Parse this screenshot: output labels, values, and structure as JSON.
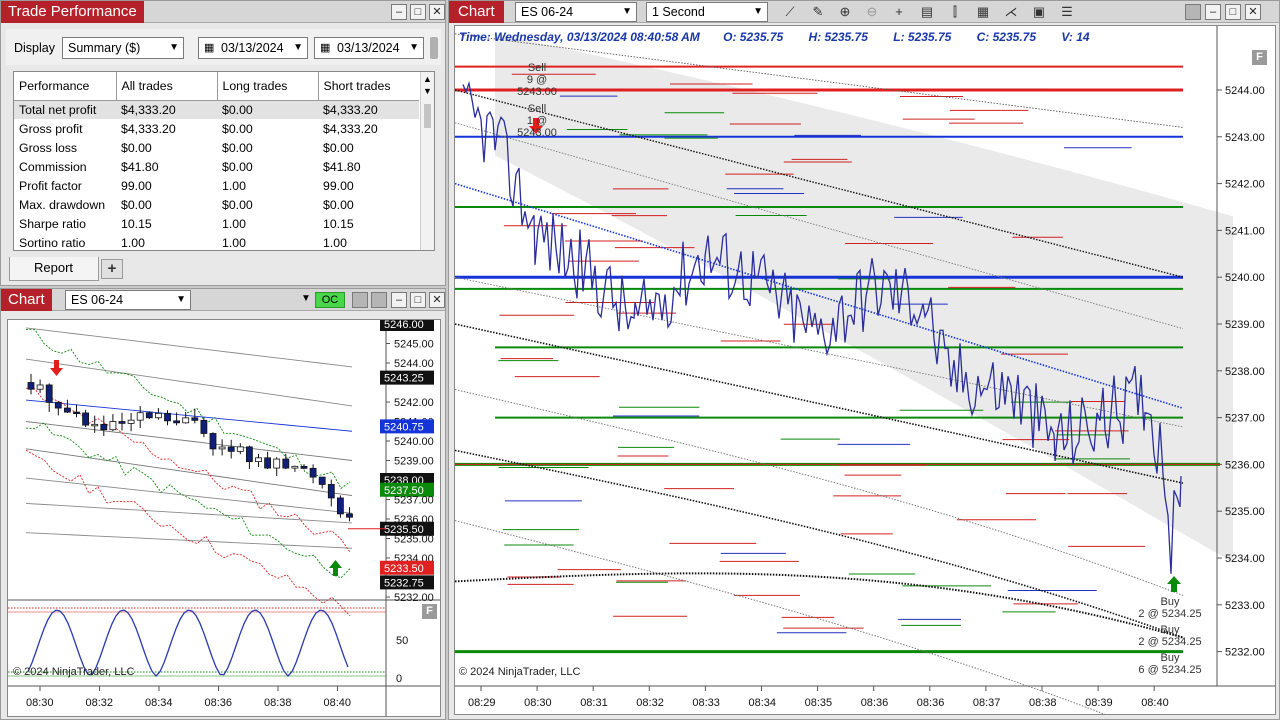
{
  "trade_performance": {
    "title": "Trade Performance",
    "display_label": "Display",
    "display_value": "Summary ($)",
    "date_from": "03/13/2024",
    "date_to": "03/13/2024",
    "tab_label": "Report",
    "columns": [
      "Performance",
      "All trades",
      "Long trades",
      "Short trades"
    ],
    "rows": [
      [
        "Total net profit",
        "$4,333.20",
        "$0.00",
        "$4,333.20"
      ],
      [
        "Gross profit",
        "$4,333.20",
        "$0.00",
        "$4,333.20"
      ],
      [
        "Gross loss",
        "$0.00",
        "$0.00",
        "$0.00"
      ],
      [
        "Commission",
        "$41.80",
        "$0.00",
        "$41.80"
      ],
      [
        "Profit factor",
        "99.00",
        "1.00",
        "99.00"
      ],
      [
        "Max. drawdown",
        "$0.00",
        "$0.00",
        "$0.00"
      ],
      [
        "Sharpe ratio",
        "10.15",
        "1.00",
        "10.15"
      ],
      [
        "Sortino ratio",
        "1.00",
        "1.00",
        "1.00"
      ]
    ]
  },
  "small_chart": {
    "title": "Chart",
    "instrument": "ES 06-24",
    "oc_label": "OC",
    "copyright": "© 2024 NinjaTrader, LLC",
    "price_axis": [
      "5246.00",
      "5245.00",
      "5244.00",
      "5243.25",
      "5242.00",
      "5241.00",
      "5240.75",
      "5240.00",
      "5239.00",
      "5238.00",
      "5237.50",
      "5237.00",
      "5236.00",
      "5235.50",
      "5235.00",
      "5234.00",
      "5233.50",
      "5232.75",
      "5232.00"
    ],
    "osc_axis": [
      "50",
      "0"
    ],
    "time_axis": [
      "08:30",
      "08:32",
      "08:34",
      "08:36",
      "08:38",
      "08:40"
    ]
  },
  "main_chart": {
    "title": "Chart",
    "instrument": "ES 06-24",
    "interval": "1 Second",
    "info_time": "Time: Wednesday, 03/13/2024 08:40:58 AM",
    "info_open": "O: 5235.75",
    "info_high": "H: 5235.75",
    "info_low": "L: 5235.75",
    "info_close": "C: 5235.75",
    "info_volume": "V: 14",
    "copyright": "© 2024 NinjaTrader, LLC",
    "price_axis": [
      "5244.00",
      "5243.00",
      "5242.00",
      "5241.00",
      "5240.00",
      "5239.00",
      "5238.00",
      "5237.00",
      "5236.00",
      "5235.00",
      "5234.00",
      "5233.00",
      "5232.00"
    ],
    "time_axis": [
      "08:29",
      "08:30",
      "08:31",
      "08:32",
      "08:33",
      "08:34",
      "08:35",
      "08:36",
      "08:36",
      "08:37",
      "08:38",
      "08:39",
      "08:40"
    ],
    "annotations": {
      "sell1_label": "Sell",
      "sell1_qty": "9 @ 5243.00",
      "sell2_label": "Sell",
      "sell2_qty": "1 @ 5243.00",
      "buy1_label": "Buy",
      "buy1_qty": "2 @ 5234.25",
      "buy2_label": "Buy",
      "buy2_qty": "2 @ 5234.25",
      "buy3_label": "Buy",
      "buy3_qty": "6 @ 5234.25"
    }
  },
  "colors": {
    "accent": "#b5202a",
    "price_line": "#2a2e9c",
    "green": "#0a8a0a",
    "red": "#e02020",
    "blue": "#1434d8"
  },
  "icons": [
    "minimize-icon",
    "maximize-icon",
    "close-icon",
    "calendar-icon",
    "line-tool-icon",
    "pencil-icon",
    "zoom-in-icon",
    "zoom-out-icon",
    "crosshair-icon",
    "properties-icon",
    "bar-type-icon",
    "indicator-icon",
    "strategy-icon",
    "data-box-icon",
    "menu-icon"
  ]
}
